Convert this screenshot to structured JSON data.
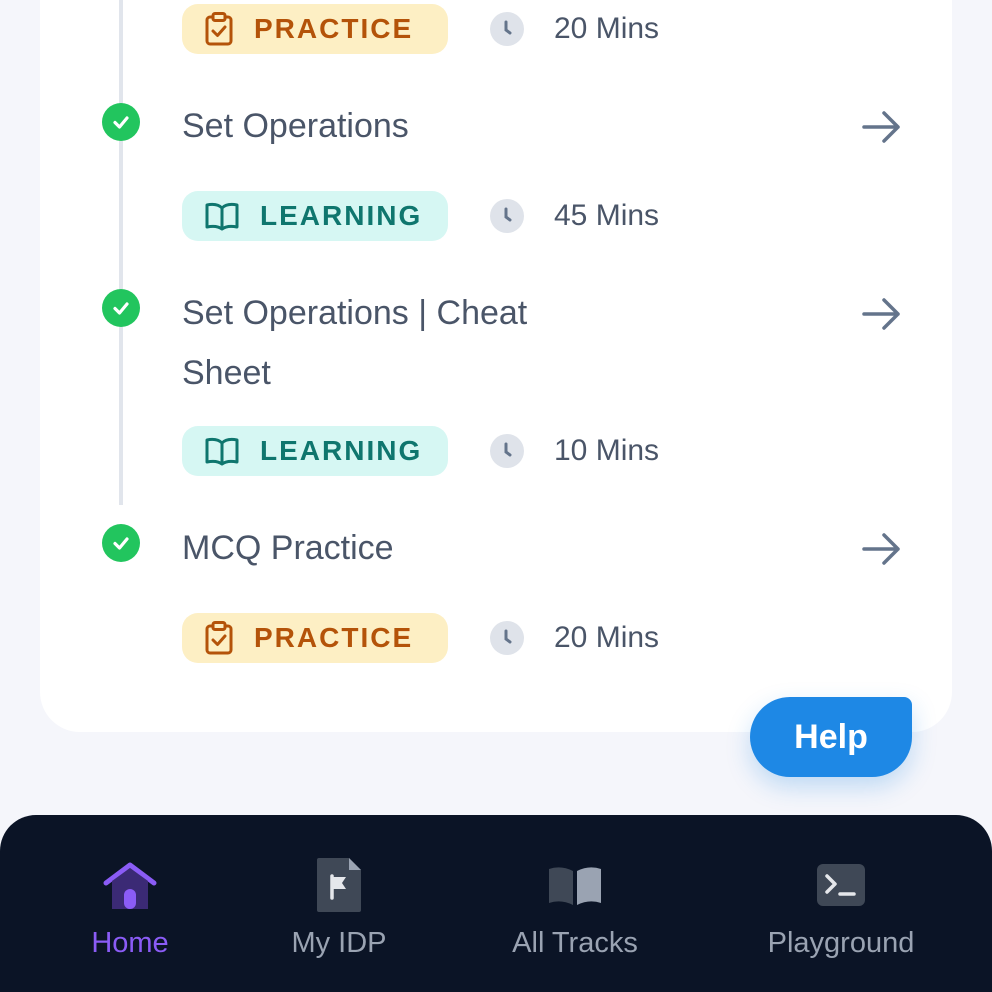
{
  "timeline": [
    {
      "id": "prev",
      "tag": {
        "label": "PRACTICE",
        "kind": "practice",
        "icon": "clipboard-check-icon"
      },
      "duration": "20 Mins"
    },
    {
      "id": "set-operations",
      "title": "Set Operations",
      "done": true,
      "tag": {
        "label": "LEARNING",
        "kind": "learning",
        "icon": "book-open-icon"
      },
      "duration": "45 Mins"
    },
    {
      "id": "cheat-sheet",
      "title": "Set Operations | Cheat Sheet",
      "done": true,
      "tag": {
        "label": "LEARNING",
        "kind": "learning",
        "icon": "book-open-icon"
      },
      "duration": "10 Mins"
    },
    {
      "id": "mcq-practice",
      "title": "MCQ Practice",
      "done": true,
      "tag": {
        "label": "PRACTICE",
        "kind": "practice",
        "icon": "clipboard-check-icon"
      },
      "duration": "20 Mins"
    }
  ],
  "help": {
    "label": "Help"
  },
  "nav": {
    "items": [
      {
        "label": "Home",
        "icon": "home-icon",
        "active": true
      },
      {
        "label": "My IDP",
        "icon": "document-flag-icon",
        "active": false
      },
      {
        "label": "All Tracks",
        "icon": "book-icon",
        "active": false
      },
      {
        "label": "Playground",
        "icon": "terminal-icon",
        "active": false
      }
    ]
  },
  "colors": {
    "check": "#22c55e",
    "practice_bg": "#fdefc4",
    "practice_text": "#b45309",
    "learning_bg": "#d6f7f3",
    "learning_text": "#0f766e",
    "help": "#1e88e5",
    "nav_bg": "#0b1426",
    "nav_active": "#8b5cf6"
  }
}
